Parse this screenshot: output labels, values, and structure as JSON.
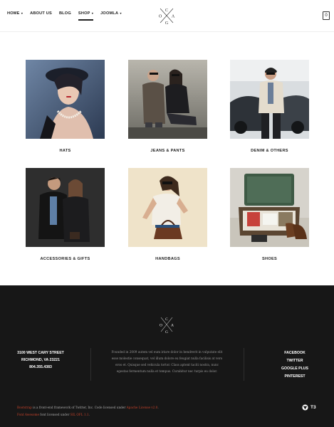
{
  "header": {
    "nav": [
      {
        "label": "HOME",
        "dropdown": true,
        "active": false
      },
      {
        "label": "ABOUT US",
        "dropdown": false,
        "active": false
      },
      {
        "label": "BLOG",
        "dropdown": false,
        "active": false
      },
      {
        "label": "SHOP",
        "dropdown": true,
        "active": true
      },
      {
        "label": "JOOMLA",
        "dropdown": true,
        "active": false
      }
    ],
    "logo_letters": {
      "top": "C",
      "left": "O",
      "right": "A",
      "bottom": "G"
    },
    "cart_count": "0"
  },
  "products": [
    {
      "label": "HATS"
    },
    {
      "label": "JEANS & PANTS"
    },
    {
      "label": "DENIM & OTHERS"
    },
    {
      "label": "ACCESSORIES & GIFTS"
    },
    {
      "label": "HANDBAGS"
    },
    {
      "label": "SHOES"
    }
  ],
  "footer": {
    "logo_letters": {
      "top": "C",
      "left": "O",
      "right": "A",
      "bottom": "G"
    },
    "address": {
      "street": "3100 WEST CARY STREET",
      "city": "RICHMOND, VA 23221",
      "phone": "804.355.4383"
    },
    "about_text": "Founded in 2009 autem vel eum iriure dolor in hendrerit in vulputate elit esse molestie consequat, vel illum dolore eu feugiat nulla facilisis at vero eros et. Quisque sed vehicula tortor. Class aptent taciti nostra, nunc egestas fermentum nulla et tempus. Curabitur nec turpis eu dolor.",
    "social": [
      "FACEBOOK",
      "TWITTER",
      "GOOGLE PLUS",
      "PINTEREST"
    ],
    "legal": {
      "bootstrap_link": "Bootstrap",
      "bootstrap_text": " is a front-end framework of Twitter, Inc. Code licensed under ",
      "apache_link": "Apache License v2.0",
      "fa_link": "Font Awesome",
      "fa_text": " font licensed under ",
      "sil_link": "SIL OFL 1.1"
    },
    "badge": "T3"
  },
  "colors": {
    "accent_red": "#c8432b",
    "footer_bg": "#171717"
  }
}
